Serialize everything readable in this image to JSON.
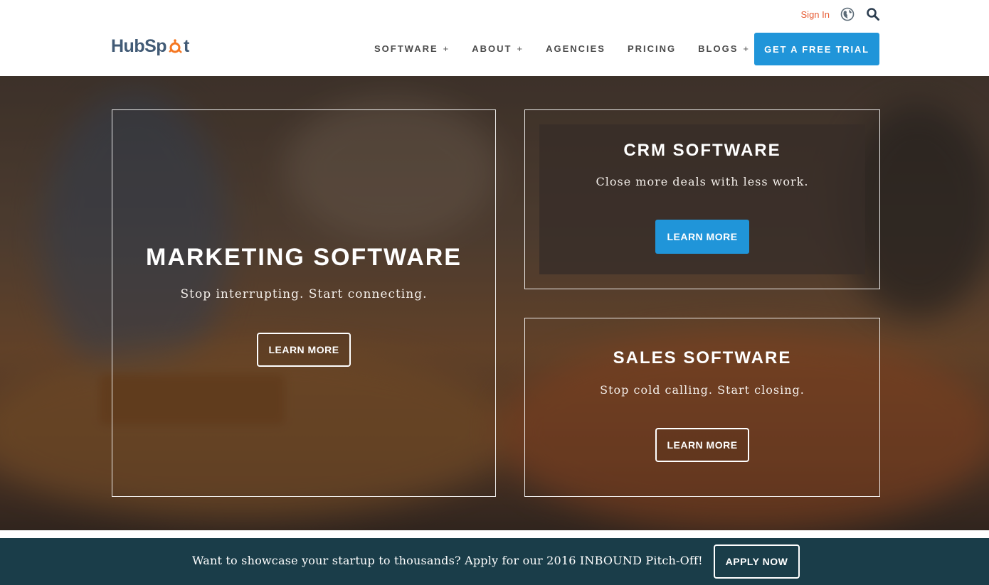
{
  "header": {
    "logo_text_left": "HubSp",
    "logo_text_right": "t",
    "sign_in": "Sign In",
    "nav": [
      {
        "label": "SOFTWARE",
        "expand": "+"
      },
      {
        "label": "ABOUT",
        "expand": "+"
      },
      {
        "label": "AGENCIES",
        "expand": ""
      },
      {
        "label": "PRICING",
        "expand": ""
      },
      {
        "label": "BLOGS",
        "expand": "+"
      }
    ],
    "cta": "GET A FREE TRIAL"
  },
  "hero": {
    "marketing": {
      "title": "MARKETING SOFTWARE",
      "tagline": "Stop interrupting. Start connecting.",
      "button": "LEARN MORE"
    },
    "crm": {
      "title": "CRM SOFTWARE",
      "tagline": "Close more deals with less work.",
      "button": "LEARN MORE"
    },
    "sales": {
      "title": "SALES SOFTWARE",
      "tagline": "Stop cold calling. Start closing.",
      "button": "LEARN MORE"
    }
  },
  "banner": {
    "text": "Want to showcase your startup to thousands? Apply for our 2016 INBOUND Pitch-Off!",
    "button": "APPLY NOW"
  },
  "colors": {
    "accent_blue": "#2095d9",
    "brand_orange": "#e65c34",
    "logo_gray": "#425b76",
    "banner_bg": "#1a3d49"
  },
  "icons": [
    "hubspot-sprocket-icon",
    "globe-icon",
    "search-icon"
  ]
}
